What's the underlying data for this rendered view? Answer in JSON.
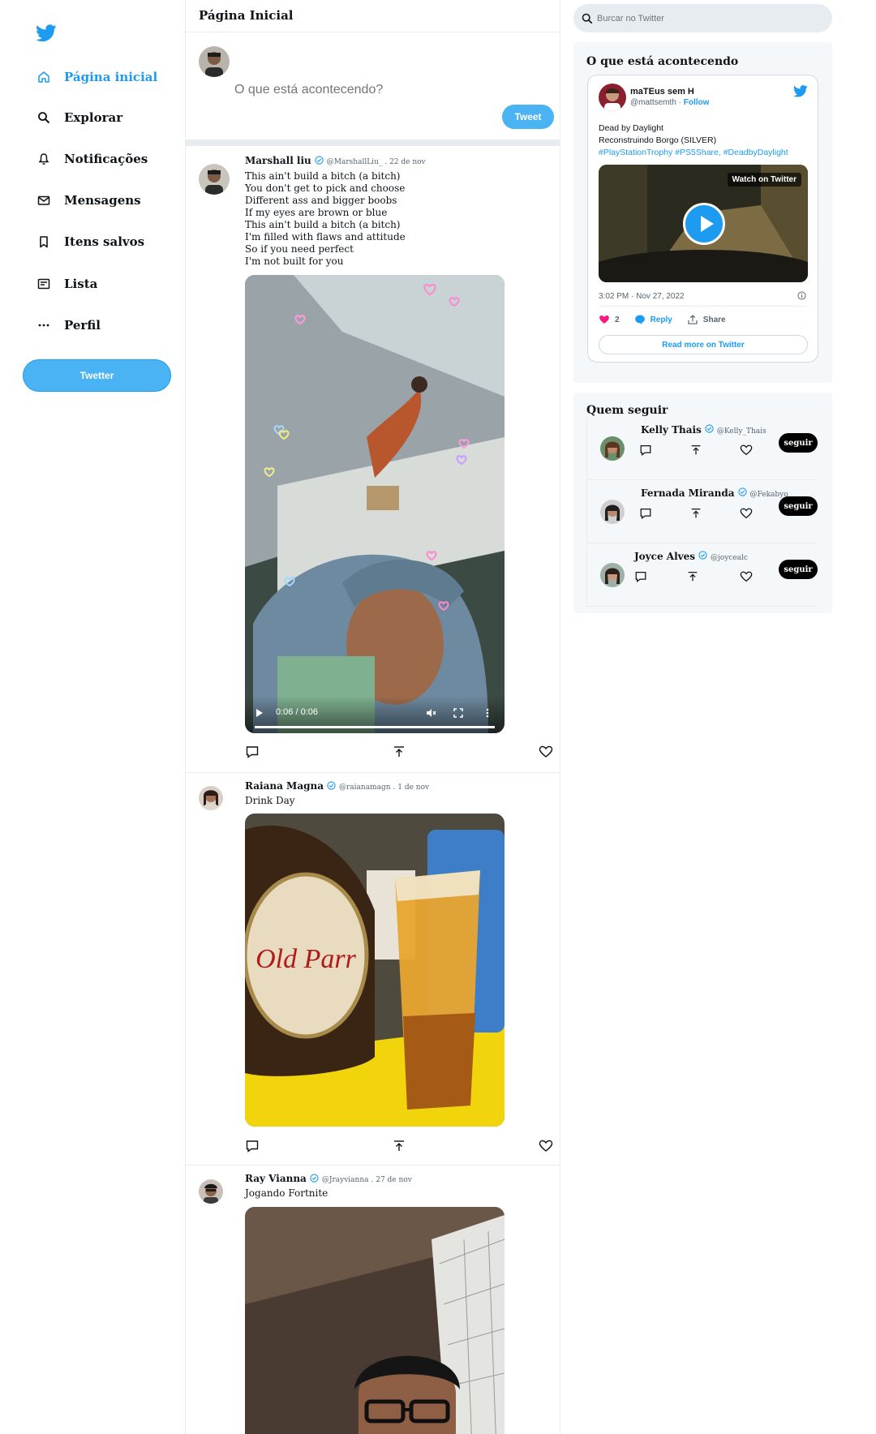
{
  "sidebar": {
    "items": [
      {
        "label": "Página inicial",
        "icon": "home-icon"
      },
      {
        "label": "Explorar",
        "icon": "search-icon"
      },
      {
        "label": "Notificações",
        "icon": "bell-icon"
      },
      {
        "label": "Mensagens",
        "icon": "mail-icon"
      },
      {
        "label": "Itens salvos",
        "icon": "bookmark-icon"
      },
      {
        "label": "Lista",
        "icon": "list-icon"
      },
      {
        "label": "Perfil",
        "icon": "more-icon"
      }
    ],
    "button_label": "Twetter"
  },
  "feed": {
    "title": "Página Inicial",
    "composer": {
      "placeholder": "O que está acontecendo?",
      "button_label": "Tweet"
    },
    "tweets": [
      {
        "name": "Marshall liu",
        "handle": "@MarshallLiu_",
        "date": ". 22 de nov",
        "lines": [
          "This ain't build a bitch (a bitch)",
          "You don't get to pick and choose",
          "Different ass and bigger boobs",
          "If my eyes are brown or blue",
          "This ain't build a bitch (a bitch)",
          "I'm filled with flaws and attitude",
          "So if you need perfect",
          "I'm not built for you"
        ],
        "video_time": "0:06 / 0:06",
        "video_progress": 1.0
      },
      {
        "name": "Raiana Magna",
        "handle": "@raianamagn",
        "date": ". 1 de nov",
        "lines": [
          "Drink Day"
        ]
      },
      {
        "name": "Ray Vianna",
        "handle": "@Jrayvianna",
        "date": ". 27 de nov",
        "lines": [
          "Jogando Fortnite"
        ]
      }
    ]
  },
  "right": {
    "search_placeholder": "Burcar no Twitter",
    "trends_title": "O que está acontecendo",
    "embed": {
      "name": "maTEus sem H",
      "handle": "@mattsemth",
      "separator": " · ",
      "follow": "Follow",
      "line1": "Dead by Daylight",
      "line2": "Reconstruindo Borgo (SILVER)",
      "tags": "#PlayStationTrophy #PS5Share, #DeadbyDaylight",
      "watch_label": "Watch on Twitter",
      "timestamp": "3:02 PM · Nov 27, 2022",
      "likes": "2",
      "reply": "Reply",
      "share": "Share",
      "read_more": "Read more on Twitter"
    },
    "follow_title": "Quem seguir",
    "follow": [
      {
        "name": "Kelly Thais",
        "handle": "@Kelly_Thais",
        "button": "seguir"
      },
      {
        "name": "Fernada Miranda",
        "handle": "@Fekabyo",
        "button": "seguir"
      },
      {
        "name": "Joyce Alves",
        "handle": "@joycealc",
        "button": "seguir"
      }
    ]
  },
  "colors": {
    "accent": "#1d9bf0",
    "button": "#4ab3f4",
    "border": "#e6ecf0",
    "panel": "#f5f8fa"
  }
}
